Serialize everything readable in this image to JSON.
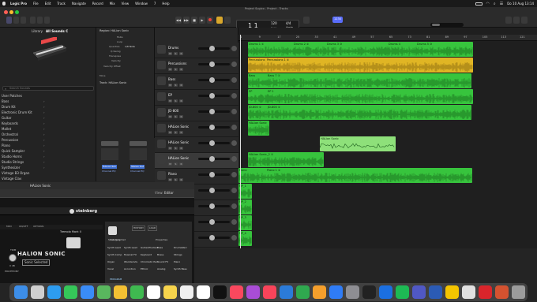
{
  "menubar": {
    "items": [
      "Logic Pro",
      "File",
      "Edit",
      "Track",
      "Navigate",
      "Record",
      "Mix",
      "View",
      "Window",
      "7",
      "Help"
    ],
    "clock": "Do 10 Aug  13:14"
  },
  "window": {
    "title": "Project Sugico - Project - Tracks"
  },
  "lcd": {
    "position": "1  1",
    "tempo": "120",
    "tempo_unit": "Keep",
    "signature": "4/4",
    "key": "Amin",
    "badge": "1234"
  },
  "library": {
    "header": "Library",
    "preset_title": "All Sounds C",
    "search_placeholder": "Search Sounds",
    "items": [
      "User Patches",
      "Bass",
      "Drum Kit",
      "Electronic Drum Kit",
      "Guitar",
      "Keyboards",
      "Mallet",
      "Orchestral",
      "Percussion",
      "Piano",
      "Quick Sampler",
      "Studio Horns",
      "Studio Strings",
      "Synthesizer",
      "Vintage B3 Organ",
      "Vintage Clav",
      "Vintage Electric Piano"
    ]
  },
  "inspector": {
    "region_label": "Region: HALion Sonic",
    "fields": [
      "Mute",
      "Loop",
      "Quantize",
      "Q-Swing",
      "Transpose",
      "Velocity",
      "Velocity Offset"
    ],
    "quantize_value": "1/8 Note",
    "more": "More",
    "track_label": "Track: HALion Sonic",
    "strip1": "HALion Son",
    "strip2": "Stereo Out",
    "strip3": "Channel EQ",
    "strip4": "Channel EQ"
  },
  "arrange_toolbar": {
    "edit": "Edit",
    "functions": "Functions",
    "view": "View",
    "snap_label": "Snap:",
    "snap_value": "Smart",
    "drag_label": "Drag:",
    "drag_value": "No Overlap"
  },
  "ruler": [
    "1",
    "9",
    "17",
    "25",
    "33",
    "41",
    "49",
    "57",
    "65",
    "73",
    "81",
    "89",
    "97",
    "105",
    "113",
    "121"
  ],
  "tracks": [
    {
      "num": "1",
      "name": "Drums"
    },
    {
      "num": "2",
      "name": "Percussions"
    },
    {
      "num": "3",
      "name": "Bass"
    },
    {
      "num": "4",
      "name": "EP"
    },
    {
      "num": "5",
      "name": "JD-800"
    },
    {
      "num": "6",
      "name": "HALion Sonic"
    },
    {
      "num": "7",
      "name": "HALion Sonic"
    },
    {
      "num": "8",
      "name": "HALion Sonic"
    },
    {
      "num": "9",
      "name": "Piano"
    },
    {
      "num": "10",
      "name": ""
    },
    {
      "num": "11",
      "name": ""
    },
    {
      "num": "12",
      "name": ""
    },
    {
      "num": "13",
      "name": ""
    }
  ],
  "regions": [
    {
      "label": "Drums 1 ①",
      "label2": "Drums 2 ②",
      "label3": "Drums 3 ③",
      "label4": "Drums 4",
      "label5": "Drums 5 ③"
    },
    {
      "label": "Percussions",
      "label2": "Percussions 1 ②"
    },
    {
      "label": "Bass",
      "label2": "Bass 7 ①"
    },
    {
      "label": "EP",
      "label2": "EP 1"
    },
    {
      "label": "JD-800 ①",
      "label2": "JD-800 ①"
    },
    {
      "label": "HALion Sonic"
    },
    {
      "label": "HALion Sonic"
    },
    {
      "label": "HALion Sonic_2 ①"
    },
    {
      "label": "Piano",
      "label2": "Piano 1 ②"
    },
    {
      "label": "NP_1"
    },
    {
      "label": "NP_2"
    },
    {
      "label": "NP_3"
    },
    {
      "label": "NP_4"
    }
  ],
  "halion": {
    "window_title": "HALion Sonic",
    "brand": "steinberg",
    "product": "HALION SONIC",
    "subtitle": "Sonic Selected",
    "preset": "Tremolo Mark II",
    "view_label": "View:",
    "view_value": "Editor",
    "tabs": [
      "MIDI",
      "ON/OFF",
      "OPTIONS"
    ],
    "browser_tabs": [
      "HISTORY",
      "LOAD"
    ],
    "filter": "Sonic Selected",
    "category_label": "Category",
    "properties_label": "Properties",
    "categories": [
      "Synth Lead",
      "Synth Lead",
      "Guitar/Plucked",
      "Bass",
      "Drum&Perc",
      "Synth Comp",
      "Musical FX",
      "Keyboard",
      "Brass",
      "Strings",
      "Organ",
      "Woodwinds",
      "Chromatic Perc",
      "Sound FX",
      "Piano",
      "Vocal",
      "Accordion",
      "Ethnic",
      "Analog",
      "Synth Bass"
    ],
    "knob1": "TRIM",
    "knob1_value": "0 dB",
    "knob2": "POLYPHONY",
    "program_label": "PROGRAM"
  },
  "dock": {
    "apps": [
      "finder",
      "launchpad",
      "safari",
      "messages",
      "mail",
      "maps",
      "photos",
      "facetime",
      "calendar",
      "notes",
      "reminders",
      "freeform",
      "tv",
      "music",
      "podcasts",
      "news",
      "keynote",
      "numbers",
      "pages",
      "appstore",
      "settings",
      "logic",
      "xcode",
      "spotify",
      "teams",
      "word",
      "typora",
      "vpn",
      "acrobat",
      "powerpoint",
      "trash"
    ],
    "colors": [
      "#3d8ee8",
      "#cfcfcf",
      "#2d9cf0",
      "#35c759",
      "#3a8cf7",
      "#59b75e",
      "#f3c033",
      "#3fb950",
      "#ffffff",
      "#f7d44c",
      "#f0f0f0",
      "#ffffff",
      "#111111",
      "#f9485e",
      "#a94dd6",
      "#f9445a",
      "#2b7bd9",
      "#2fa84f",
      "#f59f2c",
      "#2f7cf6",
      "#8e8e93",
      "#222222",
      "#1b6fe0",
      "#1db954",
      "#5058c4",
      "#2b5bb5",
      "#f4c400",
      "#e0e0e0",
      "#d9252b",
      "#d35230",
      "#9c9c9c"
    ]
  },
  "colors": {
    "region_green": "#37c43d",
    "region_yellow": "#e0b524",
    "wave_dark": "#1a6e1e",
    "accent": "#5a6dfa"
  }
}
